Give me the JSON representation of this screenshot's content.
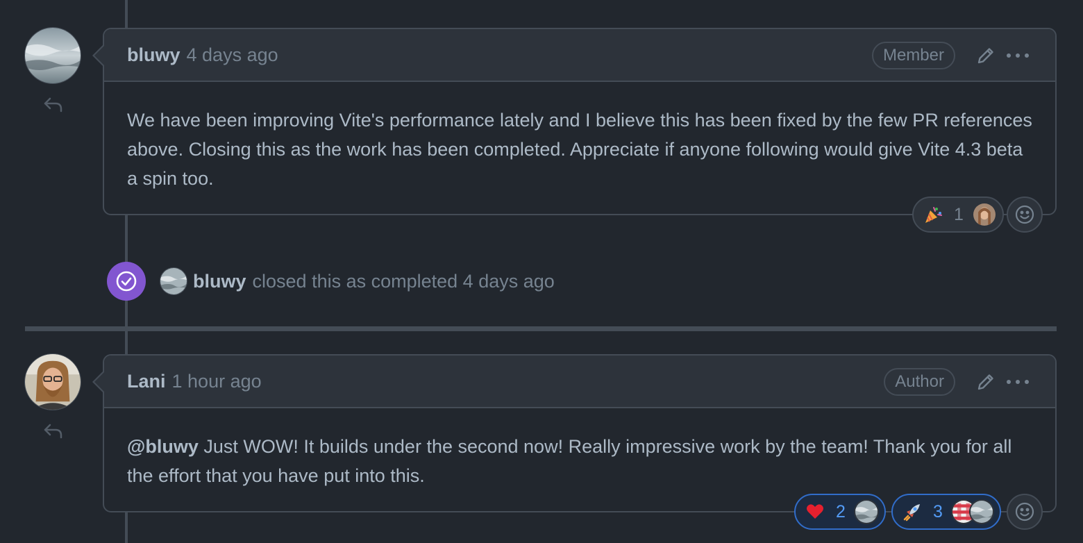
{
  "comments": [
    {
      "author": "bluwy",
      "time": "4 days ago",
      "role": "Member",
      "body": "We have been improving Vite's performance lately and I believe this has been fixed by the few PR references above. Closing this as the work has been completed. Appreciate if anyone following would give Vite 4.3 beta a spin too.",
      "reactions": [
        {
          "emoji": "tada",
          "count": "1"
        }
      ]
    },
    {
      "author": "Lani",
      "time": "1 hour ago",
      "role": "Author",
      "mention": "@bluwy",
      "body": " Just WOW! It builds under the second now! Really impressive work by the team! Thank you for all the effort that you have put into this.",
      "reactions": [
        {
          "emoji": "heart",
          "count": "2"
        },
        {
          "emoji": "rocket",
          "count": "3"
        }
      ]
    }
  ],
  "event": {
    "actor": "bluwy",
    "text": "closed this as completed 4 days ago",
    "icon": "check-circle-icon",
    "badge_color": "#8256d0"
  },
  "colors": {
    "background": "#22272e",
    "header": "#2d333b",
    "border": "#444c56",
    "accent": "#539bf5",
    "muted": "#768390"
  }
}
